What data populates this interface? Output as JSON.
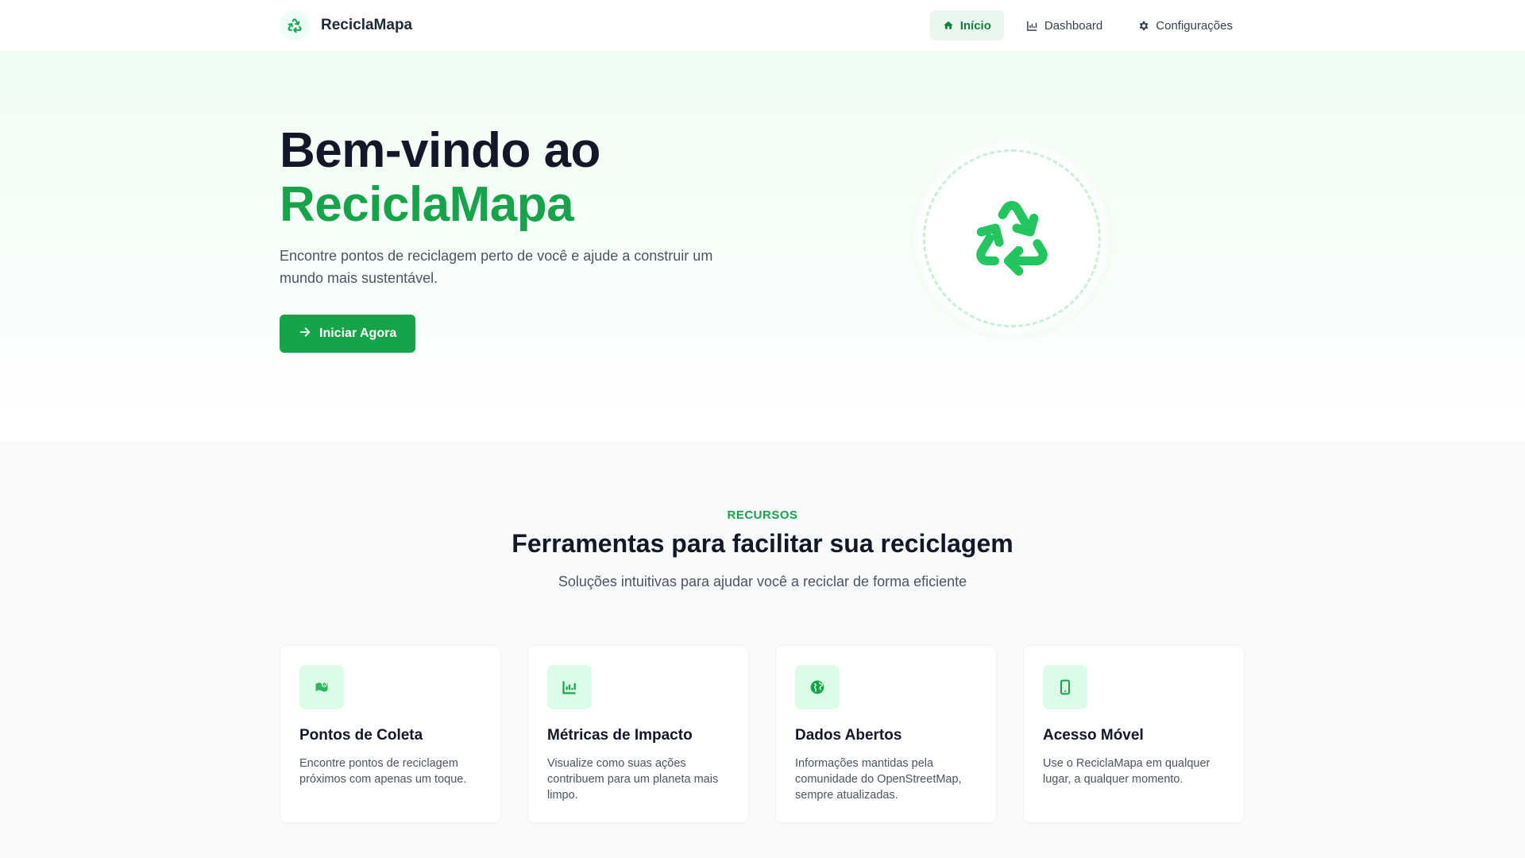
{
  "navbar": {
    "brand": "ReciclaMapa",
    "brand_icon": "recycle-icon",
    "links": [
      {
        "label": "Início",
        "icon": "home-icon",
        "active": true
      },
      {
        "label": "Dashboard",
        "icon": "chart-icon",
        "active": false
      },
      {
        "label": "Configurações",
        "icon": "gear-icon",
        "active": false
      }
    ]
  },
  "hero": {
    "title_line1": "Bem-vindo ao",
    "title_line2": "ReciclaMapa",
    "subtitle": "Encontre pontos de reciclagem perto de você e ajude a construir um mundo mais sustentável.",
    "cta_label": "Iniciar Agora",
    "cta_icon": "arrow-right-icon",
    "illustration_icon": "recycle-icon"
  },
  "features": {
    "eyebrow": "RECURSOS",
    "title": "Ferramentas para facilitar sua reciclagem",
    "subtitle": "Soluções intuitivas para ajudar você a reciclar de forma eficiente",
    "cards": [
      {
        "icon": "map-location-icon",
        "title": "Pontos de Coleta",
        "text": "Encontre pontos de reciclagem próximos com apenas um toque."
      },
      {
        "icon": "chart-icon",
        "title": "Métricas de Impacto",
        "text": "Visualize como suas ações contribuem para um planeta mais limpo."
      },
      {
        "icon": "globe-icon",
        "title": "Dados Abertos",
        "text": "Informações mantidas pela comunidade do OpenStreetMap, sempre atualizadas."
      },
      {
        "icon": "mobile-icon",
        "title": "Acesso Móvel",
        "text": "Use o ReciclaMapa em qualquer lugar, a qualquer momento."
      }
    ]
  },
  "colors": {
    "primary": "#16a34a",
    "primary_light": "#dcfce7",
    "text_dark": "#111827",
    "text_muted": "#4b5563"
  }
}
